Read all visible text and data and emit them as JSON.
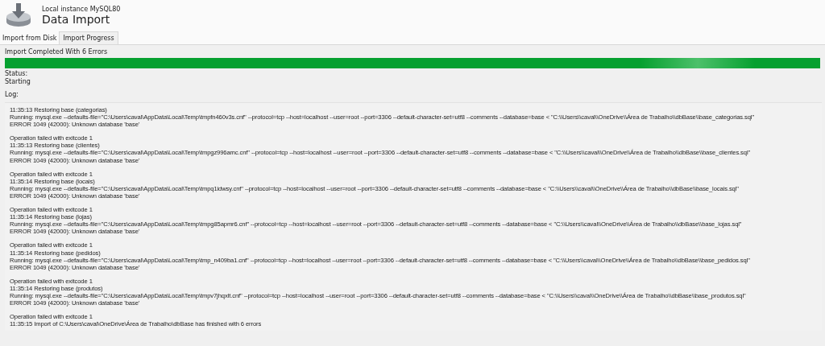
{
  "header": {
    "subtitle": "Local instance MySQL80",
    "title": "Data Import"
  },
  "tabs": [
    {
      "label": "Import from Disk",
      "selected": false
    },
    {
      "label": "Import Progress",
      "selected": true
    }
  ],
  "progress": {
    "label": "Import Completed With 6 Errors",
    "level": 1
  },
  "status": {
    "label": "Status:",
    "value": "Starting"
  },
  "log": {
    "label": "Log:",
    "entries": [
      {
        "lines": [
          "11:35:13 Restoring base (categorias)",
          "Running: mysql.exe --defaults-file=\"C:\\Users\\caval\\AppData\\Local\\Temp\\tmpfn460v3s.cnf\"  --protocol=tcp --host=localhost --user=root --port=3306 --default-character-set=utf8 --comments --database=base < \"C:\\\\Users\\\\caval\\\\OneDrive\\\\Área de Trabalho\\\\dbBase\\\\base_categorias.sql\"",
          "ERROR 1049 (42000): Unknown database 'base'"
        ]
      },
      {
        "lines": [
          "Operation failed with exitcode 1",
          "11:35:13 Restoring base (clientes)",
          "Running: mysql.exe --defaults-file=\"C:\\Users\\caval\\AppData\\Local\\Temp\\tmpgz996amc.cnf\"  --protocol=tcp --host=localhost --user=root --port=3306 --default-character-set=utf8 --comments --database=base < \"C:\\\\Users\\\\caval\\\\OneDrive\\\\Área de Trabalho\\\\dbBase\\\\base_clientes.sql\"",
          "ERROR 1049 (42000): Unknown database 'base'"
        ]
      },
      {
        "lines": [
          "Operation failed with exitcode 1",
          "11:35:14 Restoring base (locais)",
          "Running: mysql.exe --defaults-file=\"C:\\Users\\caval\\AppData\\Local\\Temp\\tmpq1idwsy.cnf\"  --protocol=tcp --host=localhost --user=root --port=3306 --default-character-set=utf8 --comments --database=base < \"C:\\\\Users\\\\caval\\\\OneDrive\\\\Área de Trabalho\\\\dbBase\\\\base_locais.sql\"",
          "ERROR 1049 (42000): Unknown database 'base'"
        ]
      },
      {
        "lines": [
          "Operation failed with exitcode 1",
          "11:35:14 Restoring base (lojas)",
          "Running: mysql.exe --defaults-file=\"C:\\Users\\caval\\AppData\\Local\\Temp\\tmpg85apmr6.cnf\"  --protocol=tcp --host=localhost --user=root --port=3306 --default-character-set=utf8 --comments --database=base < \"C:\\\\Users\\\\caval\\\\OneDrive\\\\Área de Trabalho\\\\dbBase\\\\base_lojas.sql\"",
          "ERROR 1049 (42000): Unknown database 'base'"
        ]
      },
      {
        "lines": [
          "Operation failed with exitcode 1",
          "11:35:14 Restoring base (pedidos)",
          "Running: mysql.exe --defaults-file=\"C:\\Users\\caval\\AppData\\Local\\Temp\\tmp_n409ba1.cnf\"  --protocol=tcp --host=localhost --user=root --port=3306 --default-character-set=utf8 --comments --database=base < \"C:\\\\Users\\\\caval\\\\OneDrive\\\\Área de Trabalho\\\\dbBase\\\\base_pedidos.sql\"",
          "ERROR 1049 (42000): Unknown database 'base'"
        ]
      },
      {
        "lines": [
          "Operation failed with exitcode 1",
          "11:35:14 Restoring base (produtos)",
          "Running: mysql.exe --defaults-file=\"C:\\Users\\caval\\AppData\\Local\\Temp\\tmpv7jhqxlt.cnf\"  --protocol=tcp --host=localhost --user=root --port=3306 --default-character-set=utf8 --comments --database=base < \"C:\\\\Users\\\\caval\\\\OneDrive\\\\Área de Trabalho\\\\dbBase\\\\base_produtos.sql\"",
          "ERROR 1049 (42000): Unknown database 'base'"
        ]
      },
      {
        "lines": [
          "Operation failed with exitcode 1",
          "11:35:15 Import of C:\\Users\\caval\\OneDrive\\Área de Trabalho\\dbBase has finished with 6 errors"
        ]
      }
    ]
  }
}
